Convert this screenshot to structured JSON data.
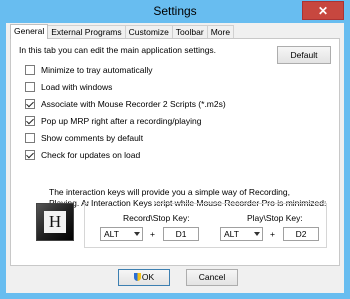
{
  "window": {
    "title": "Settings",
    "close_glyph": "✕"
  },
  "tabs": [
    {
      "label": "General",
      "active": true
    },
    {
      "label": "External Programs",
      "active": false
    },
    {
      "label": "Customize",
      "active": false
    },
    {
      "label": "Toolbar",
      "active": false
    },
    {
      "label": "More",
      "active": false
    }
  ],
  "general": {
    "intro": "In this tab you can edit the main application settings.",
    "default_button": "Default",
    "options": [
      {
        "label": "Minimize to tray automatically",
        "checked": false
      },
      {
        "label": "Load with windows",
        "checked": false
      },
      {
        "label": "Associate with Mouse Recorder 2 Scripts (*.m2s)",
        "checked": true
      },
      {
        "label": "Pop up MRP right after a recording/playing",
        "checked": true
      },
      {
        "label": "Show comments by default",
        "checked": false
      },
      {
        "label": "Check for updates on load",
        "checked": true
      }
    ],
    "info_line1": "The interaction keys will provide you a simple way of Recording,",
    "info_line2": "Playing. And stopping your script while Mouse Recorder Pro is minimized:",
    "logo_letter": "H",
    "keys": {
      "group_title": "Interaction Keys",
      "record_label": "Record\\Stop Key:",
      "record_modifier": "ALT",
      "record_key": "D1",
      "play_label": "Play\\Stop Key:",
      "play_modifier": "ALT",
      "play_key": "D2",
      "plus": "+"
    }
  },
  "buttons": {
    "ok": "OK",
    "cancel": "Cancel"
  },
  "colors": {
    "title_bar": "#68bdf0",
    "close_button": "#c7473f"
  }
}
